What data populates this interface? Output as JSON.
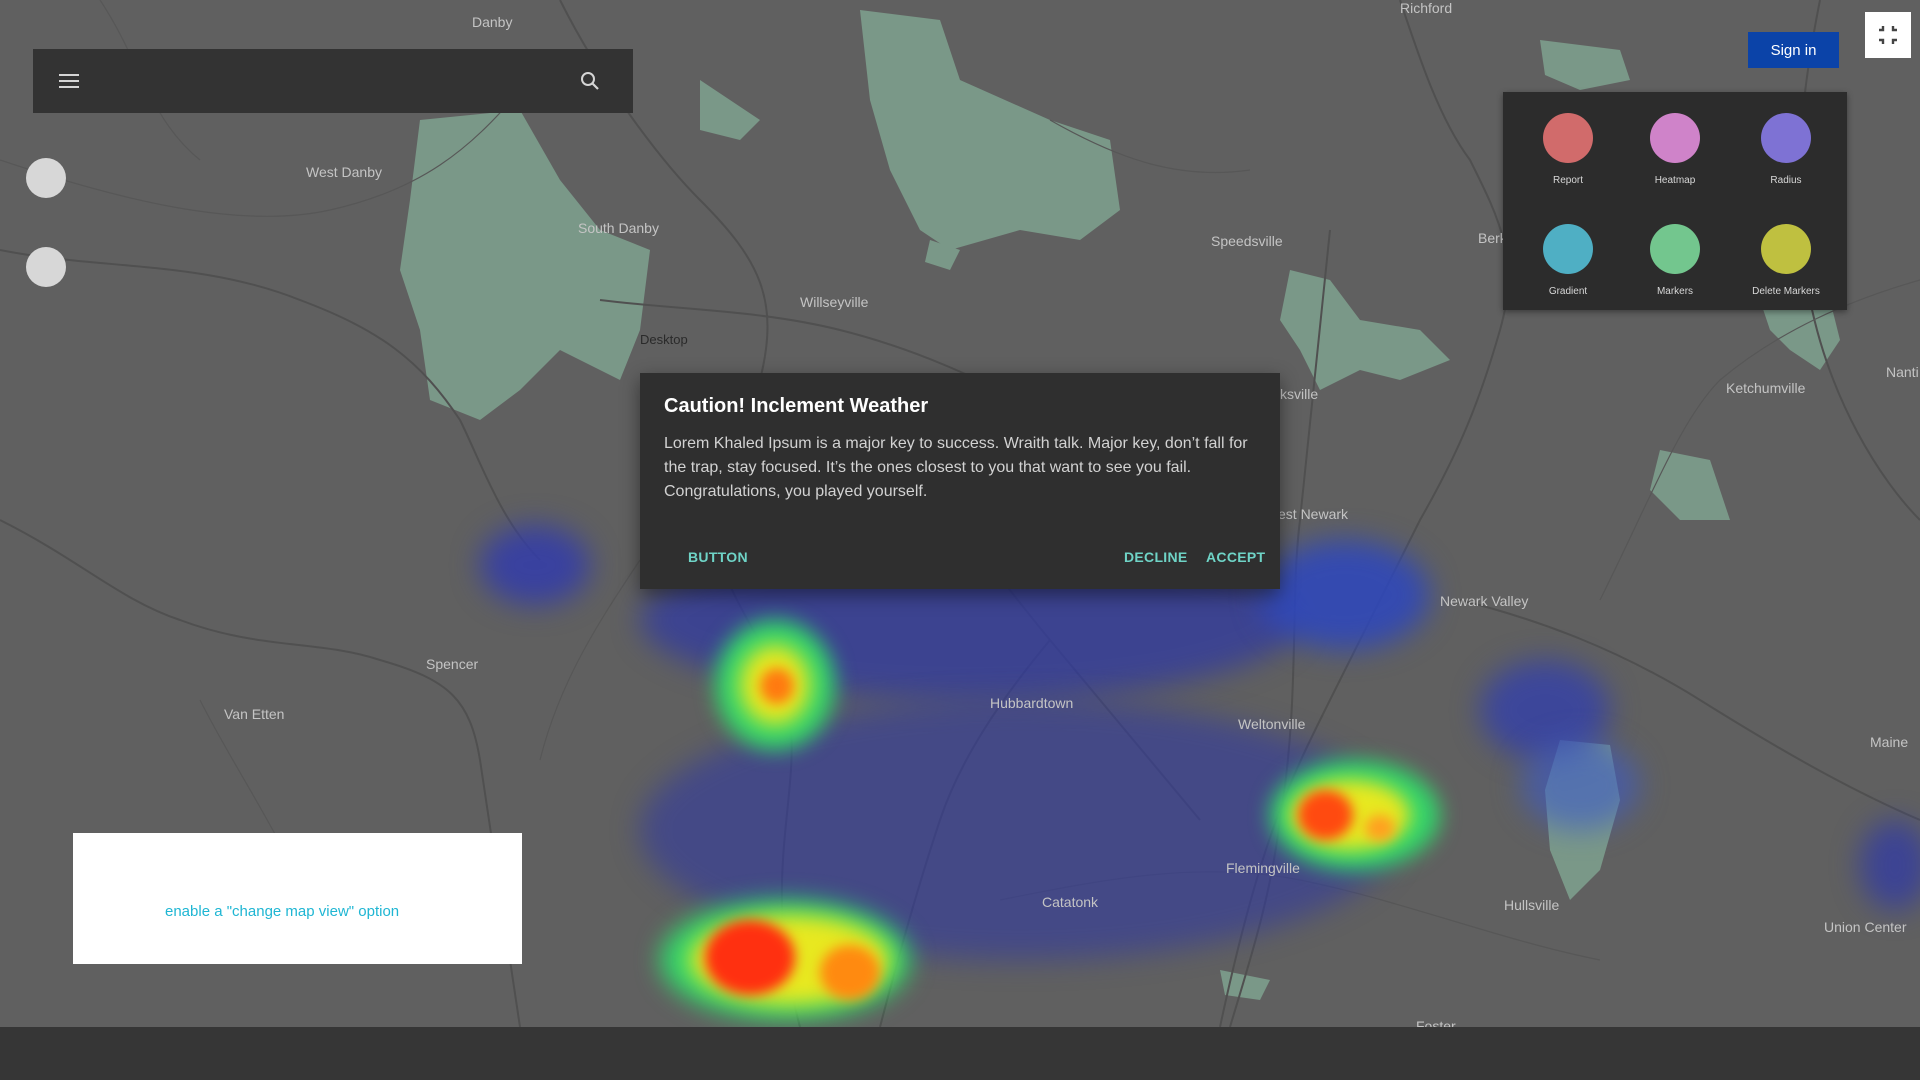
{
  "map": {
    "places": [
      {
        "name": "Danby",
        "id": "danby"
      },
      {
        "name": "Richford",
        "id": "richford"
      },
      {
        "name": "West Danby",
        "id": "west-danby"
      },
      {
        "name": "South Danby",
        "id": "south-danby"
      },
      {
        "name": "Willseyville",
        "id": "willseyville"
      },
      {
        "name": "Speedsville",
        "id": "speedsville"
      },
      {
        "name": "Berkshire",
        "id": "berkshire"
      },
      {
        "name": "Ketchumville",
        "id": "ketchumville"
      },
      {
        "name": "Nanti",
        "id": "nanti"
      },
      {
        "name": "Desktop",
        "id": "desktop"
      },
      {
        "name": "ksville",
        "id": "ksville"
      },
      {
        "name": "est Newark",
        "id": "est-newark"
      },
      {
        "name": "Newark Valley",
        "id": "newark-valley"
      },
      {
        "name": "Spencer",
        "id": "spencer"
      },
      {
        "name": "Van Etten",
        "id": "van-etten"
      },
      {
        "name": "Hubbardtown",
        "id": "hubbardtown"
      },
      {
        "name": "Weltonville",
        "id": "weltonville"
      },
      {
        "name": "Maine",
        "id": "maine"
      },
      {
        "name": "Flemingville",
        "id": "flemingville"
      },
      {
        "name": "Catatonk",
        "id": "catatonk"
      },
      {
        "name": "Hullsville",
        "id": "hullsville"
      },
      {
        "name": "Union Center",
        "id": "union-center"
      },
      {
        "name": "Foster",
        "id": "foster"
      }
    ]
  },
  "header": {
    "menu_icon": "menu-icon",
    "search_icon": "search-icon",
    "signin_label": "Sign in",
    "fullscreen_icon": "fullscreen-exit-icon"
  },
  "tools": [
    {
      "label": "Report",
      "color": "#d16b6b"
    },
    {
      "label": "Heatmap",
      "color": "#cf83c9"
    },
    {
      "label": "Radius",
      "color": "#7e72d4"
    },
    {
      "label": "Gradient",
      "color": "#4fafc4"
    },
    {
      "label": "Markers",
      "color": "#73c68e"
    },
    {
      "label": "Delete Markers",
      "color": "#bfc040"
    }
  ],
  "dialog": {
    "title": "Caution! Inclement Weather",
    "body": "Lorem Khaled Ipsum is a major key to success. Wraith talk. Major key, don’t fall for the trap, stay focused. It’s the ones closest to you that want to see you fail. Congratulations, you played yourself.",
    "button_label": "BUTTON",
    "decline_label": "DECLINE",
    "accept_label": "ACCEPT"
  },
  "info_card": {
    "link_text": "enable a \"change map view\" option"
  }
}
